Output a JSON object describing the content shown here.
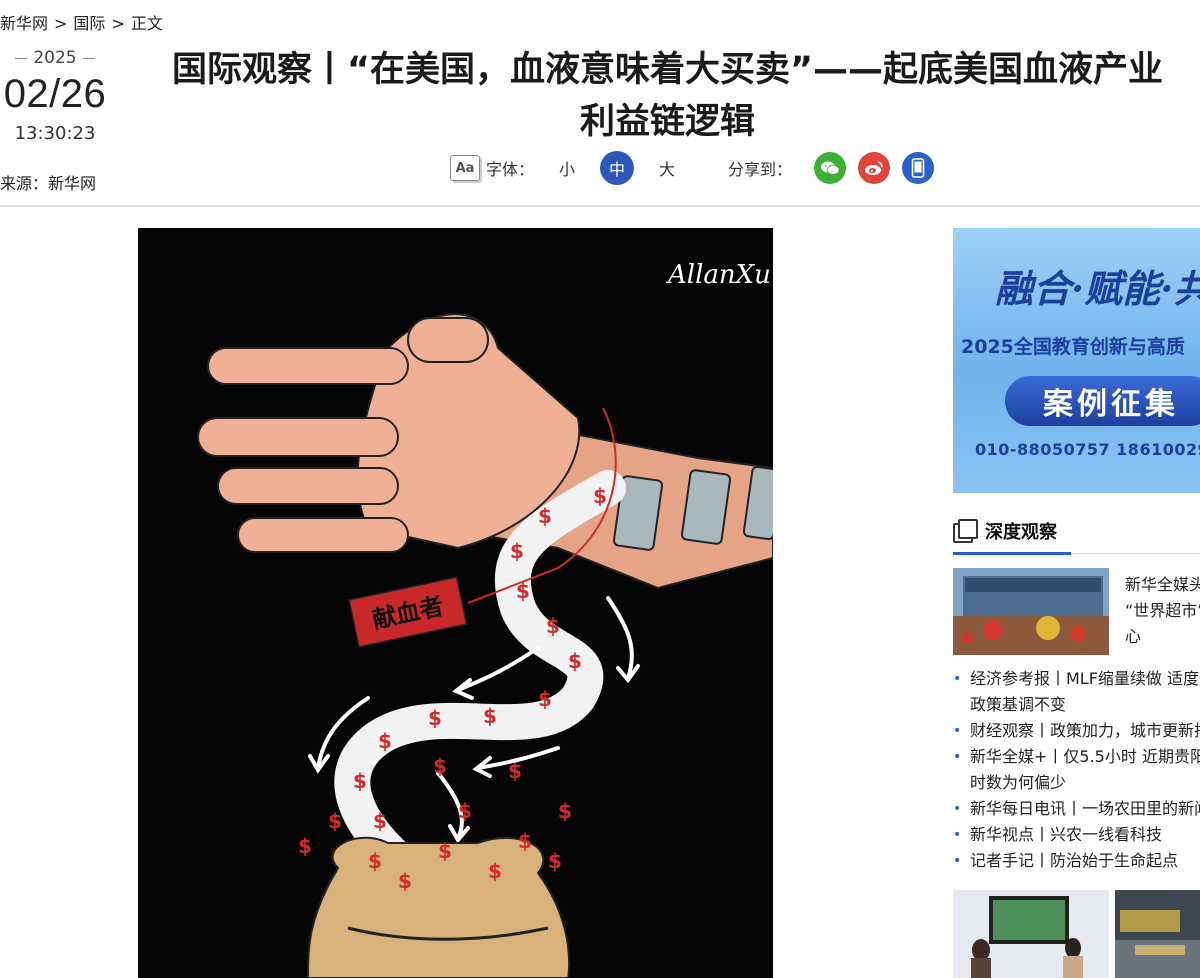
{
  "breadcrumb": {
    "home": "新华网",
    "section": "国际",
    "current": "正文",
    "sep": ">"
  },
  "date": {
    "year": "2025",
    "month_day": "02/26",
    "time": "13:30:23"
  },
  "source": "来源：新华网",
  "article": {
    "title_line1": "国际观察丨“在美国，血液意味着大买卖”——起底美国血液产业",
    "title_line2": "利益链逻辑"
  },
  "toolbar": {
    "aa": "Aa",
    "font_label": "字体：",
    "sizes": [
      "小",
      "中",
      "大"
    ],
    "active_size": "中",
    "share_label": "分享到："
  },
  "cartoon": {
    "signature": "AllanXu",
    "tag": "献血者",
    "currency": "$"
  },
  "ad": {
    "slogan": "融合·赋能·共",
    "title": "2025全国教育创新与高质",
    "button": "案例征集",
    "phone": "010-88050757  18610029"
  },
  "sidebar": {
    "section_title": "深度观察",
    "feature_text": "新华全媒头\n“世界超市”\n心",
    "news": [
      "经济参考报丨MLF缩量续做 适度\n政策基调不变",
      "财经观察丨政策加力，城市更新扬",
      "新华全媒+丨仅5.5小时 近期贵阳\n时数为何偏少",
      "新华每日电讯丨一场农田里的新闻",
      "新华视点丨兴农一线看科技",
      "记者手记丨防治始于生命起点"
    ]
  },
  "colors": {
    "accent": "#2e58b8",
    "wechat": "#3cb035",
    "weibo": "#e0453a",
    "mobile": "#2b62c8"
  }
}
